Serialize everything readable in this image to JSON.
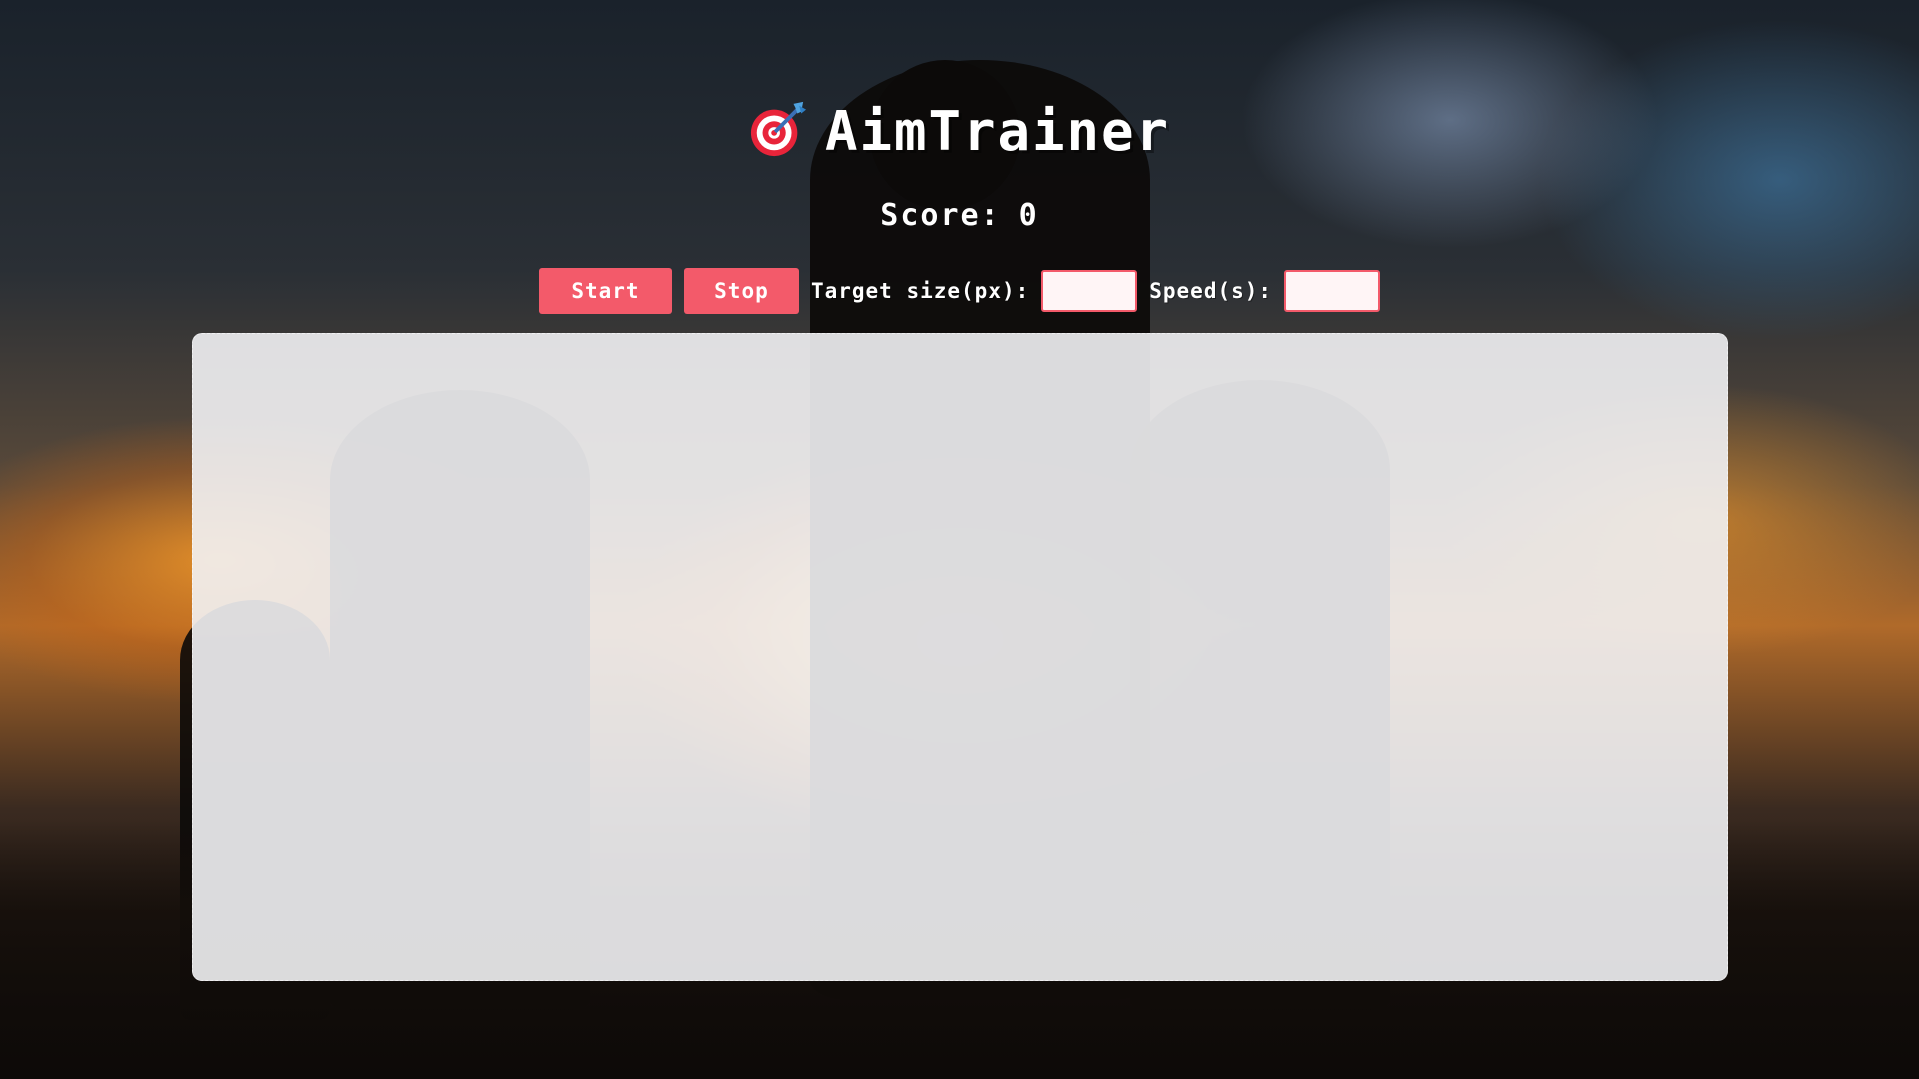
{
  "app": {
    "title": "AimTrainer",
    "title_icon": "dart-target-icon"
  },
  "score": {
    "label": "Score:",
    "value": "0"
  },
  "controls": {
    "start_label": "Start",
    "stop_label": "Stop",
    "target_size_label": "Target size(px):",
    "target_size_value": "",
    "speed_label": "Speed(s):",
    "speed_value": ""
  },
  "colors": {
    "accent": "#f35a6a",
    "arena": "#f2f2f4"
  }
}
